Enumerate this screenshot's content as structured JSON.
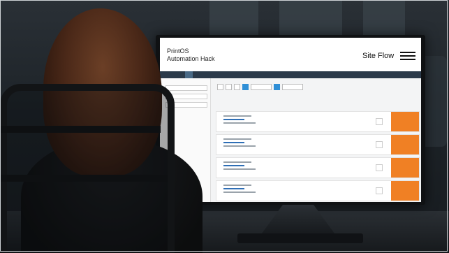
{
  "screen": {
    "header": {
      "brand_line1": "PrintOS",
      "brand_line2": "Automation Hack",
      "product": "Site Flow",
      "menu_icon": "hamburger-menu-icon"
    },
    "accent_color": "#f08024",
    "nav_color": "#2b3a4a"
  }
}
